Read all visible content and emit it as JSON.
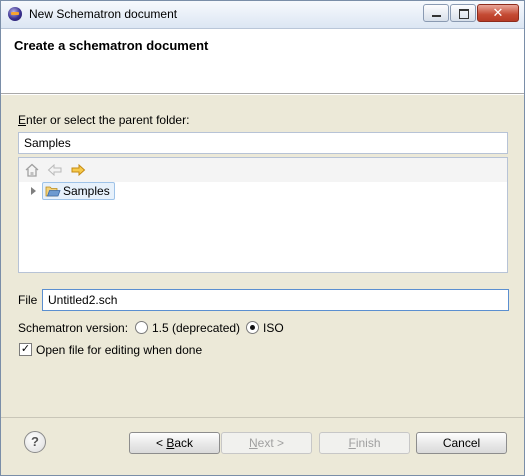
{
  "window": {
    "title": "New Schematron document"
  },
  "banner": {
    "title": "Create a schematron document"
  },
  "parent_folder": {
    "label": "Enter or select the parent folder:",
    "value": "Samples"
  },
  "tree": {
    "items": [
      {
        "label": "Samples",
        "icon": "open-folder-icon",
        "selected": true
      }
    ]
  },
  "file": {
    "label": "File",
    "value": "Untitled2.sch"
  },
  "version": {
    "label": "Schematron version:",
    "options": [
      {
        "label": "1.5 (deprecated)",
        "selected": false
      },
      {
        "label": "ISO",
        "selected": true
      }
    ]
  },
  "open_for_editing": {
    "label": "Open file for editing when done",
    "checked": true
  },
  "buttons": {
    "help": "?",
    "back_prefix": "< ",
    "back_accel": "B",
    "back_rest": "ack",
    "next_accel": "N",
    "next_rest": "ext >",
    "finish_accel": "F",
    "finish_rest": "inish",
    "cancel": "Cancel"
  }
}
